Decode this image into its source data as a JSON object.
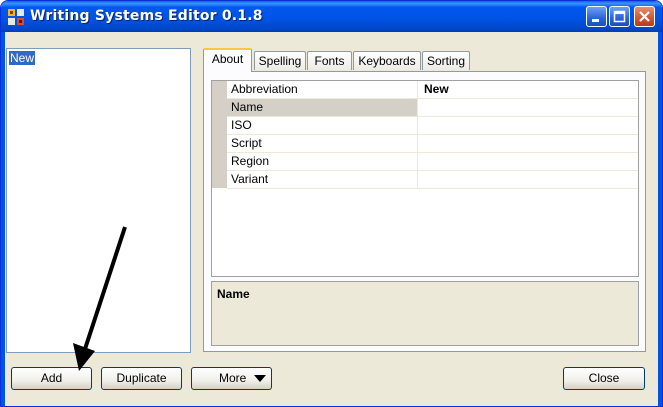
{
  "window": {
    "title": "Writing Systems Editor 0.1.8"
  },
  "writing_systems_list": {
    "items": [
      "New"
    ]
  },
  "tabs": [
    "About",
    "Spelling",
    "Fonts",
    "Keyboards",
    "Sorting"
  ],
  "active_tab": "About",
  "properties": [
    {
      "name": "Abbreviation",
      "value": "New"
    },
    {
      "name": "Name",
      "value": ""
    },
    {
      "name": "ISO",
      "value": ""
    },
    {
      "name": "Script",
      "value": ""
    },
    {
      "name": "Region",
      "value": ""
    },
    {
      "name": "Variant",
      "value": ""
    }
  ],
  "selected_property": "Name",
  "description": {
    "title": "Name"
  },
  "buttons": {
    "add": "Add",
    "duplicate": "Duplicate",
    "more": "More",
    "close": "Close"
  },
  "colors": {
    "titlebar": "#0054e3",
    "selection": "#316ac5",
    "active_tab_accent": "#ffc83c"
  }
}
